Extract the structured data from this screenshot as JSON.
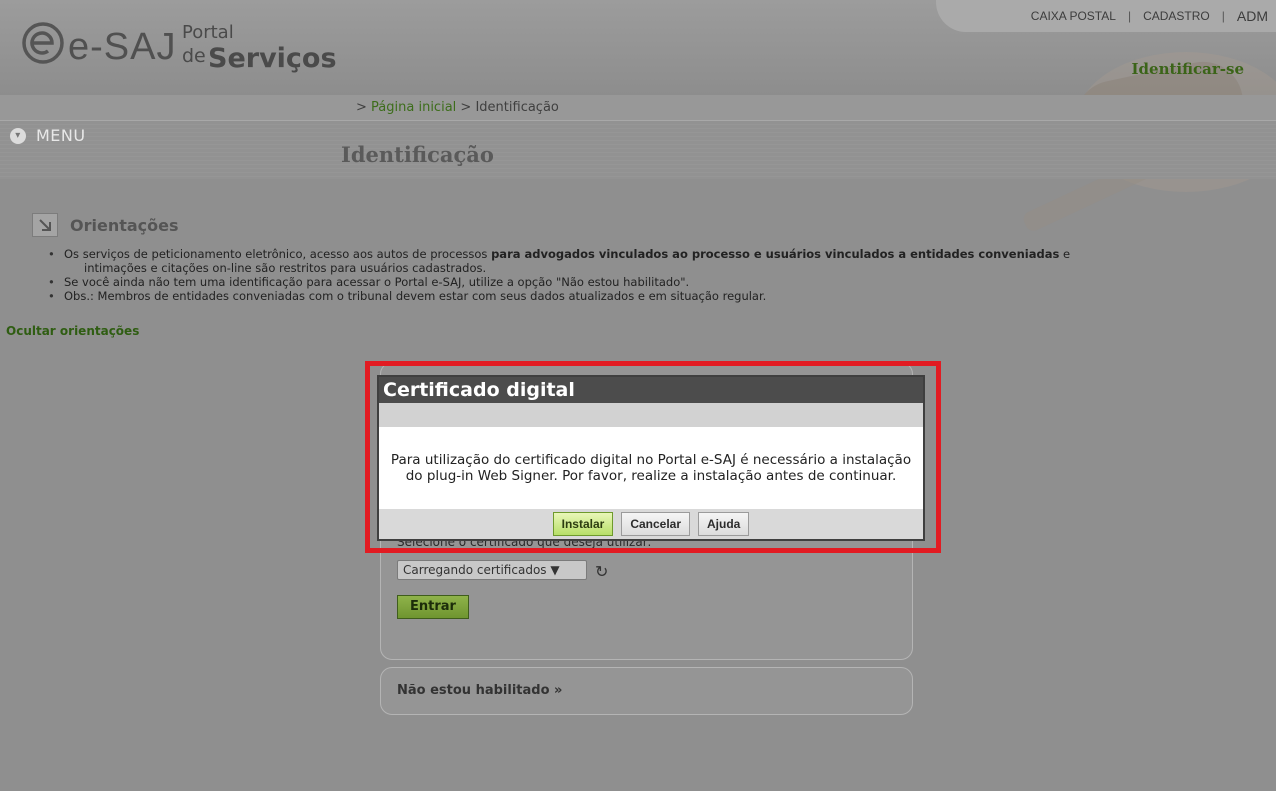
{
  "header": {
    "logo_main": "e-SAJ",
    "logo_portal": "Portal",
    "logo_de": "de",
    "logo_servicos": "Serviços",
    "top_nav": [
      "CAIXA POSTAL",
      "CADASTRO",
      "ADM"
    ],
    "identify_link": "Identificar-se"
  },
  "breadcrumb": {
    "sep": ">",
    "home": "Página inicial",
    "current": "Identificação"
  },
  "menu": {
    "label": "MENU"
  },
  "page": {
    "title": "Identificação"
  },
  "guidance": {
    "title": "Orientações",
    "item1_normal": "Os serviços de peticionamento eletrônico, acesso aos autos de processos ",
    "item1_bold": "para advogados vinculados ao processo e usuários vinculados a entidades conveniadas",
    "item1_end": " e",
    "item1_line2": "intimações e citações on-line são restritos para usuários cadastrados.",
    "item2": "Se você ainda não tem uma identificação para acessar o Portal e-SAJ, utilize a opção \"Não estou habilitado\".",
    "item3": "Obs.: Membros de entidades conveniadas com o tribunal devem estar com seus dados atualizados e em situação regular.",
    "hide_link": "Ocultar orientações"
  },
  "login": {
    "select_label": "Selecione o certificado que deseja utilizar:",
    "select_value": "Carregando certificados ▼",
    "enter_button": "Entrar",
    "not_enabled": "Não estou habilitado »"
  },
  "modal": {
    "title": "Certificado digital",
    "message": "Para utilização do certificado digital no Portal e-SAJ é necessário a instalação do plug-in Web Signer. Por favor, realize a instalação antes de continuar.",
    "install_button": "Instalar",
    "cancel_button": "Cancelar",
    "help_button": "Ajuda"
  },
  "colors": {
    "highlight": "#e21b22",
    "link_green": "#3b6418",
    "modal_title_bg": "#4c4c4c"
  },
  "icons": {
    "logo": "e-at-logo-icon",
    "menu": "chevron-down-circle-icon",
    "guidance": "arrow-down-right-icon",
    "refresh": "refresh-icon"
  }
}
